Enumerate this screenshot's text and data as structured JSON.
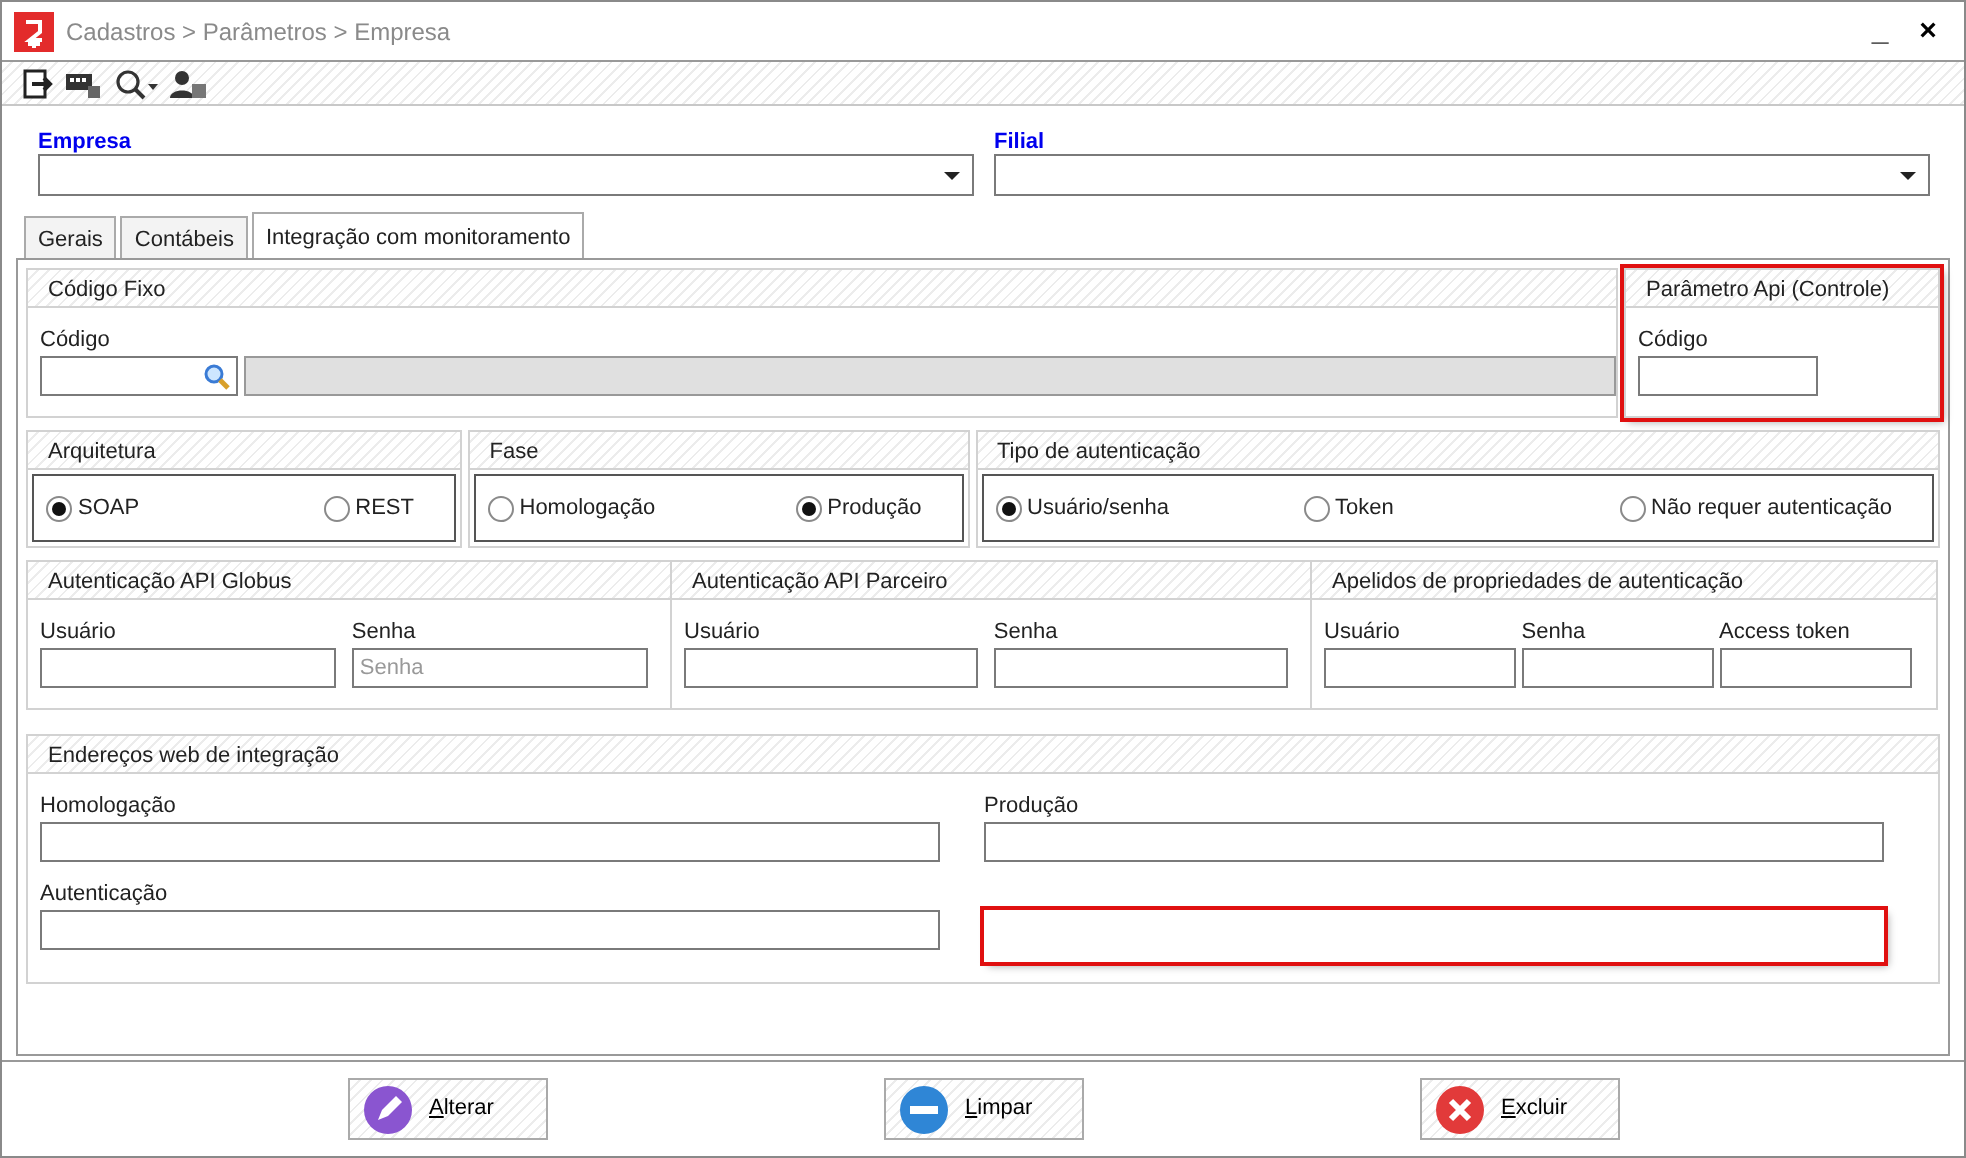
{
  "window": {
    "title": "Cadastros > Parâmetros > Empresa",
    "controls": [
      "_",
      "×"
    ]
  },
  "toolbar": [
    {
      "kind": "exit"
    },
    {
      "kind": "keyboard"
    },
    {
      "kind": "search"
    },
    {
      "kind": "user"
    }
  ],
  "selectors": [
    {
      "label": "Empresa"
    },
    {
      "label": "Filial"
    }
  ],
  "tabs": [
    {
      "label": "Gerais",
      "selected": false
    },
    {
      "label": "Contábeis",
      "selected": false
    },
    {
      "label": "Integração com monitoramento",
      "selected": true
    }
  ],
  "codigo_fixo": {
    "title": "Código Fixo",
    "field_label": "Código"
  },
  "parametro_api": {
    "title": "Parâmetro Api (Controle)",
    "field_label": "Código",
    "highlighted": true
  },
  "radio_groups": [
    {
      "title": "Arquitetura",
      "options": [
        {
          "label": "SOAP",
          "selected": true
        },
        {
          "label": "REST",
          "selected": false
        }
      ]
    },
    {
      "title": "Fase",
      "options": [
        {
          "label": "Homologação",
          "selected": false
        },
        {
          "label": "Produção",
          "selected": true
        }
      ]
    },
    {
      "title": "Tipo de autenticação",
      "options": [
        {
          "label": "Usuário/senha",
          "selected": true
        },
        {
          "label": "Token",
          "selected": false
        },
        {
          "label": "Não requer autenticação",
          "selected": false
        }
      ]
    }
  ],
  "auth_panels": [
    {
      "title": "Autenticação API Globus",
      "fields": [
        {
          "label": "Usuário"
        },
        {
          "label": "Senha",
          "placeholder": "Senha"
        }
      ]
    },
    {
      "title": "Autenticação API Parceiro",
      "fields": [
        {
          "label": "Usuário"
        },
        {
          "label": "Senha"
        }
      ]
    },
    {
      "title": "Apelidos de propriedades de autenticação",
      "fields": [
        {
          "label": "Usuário"
        },
        {
          "label": "Senha"
        },
        {
          "label": "Access token"
        }
      ]
    }
  ],
  "urls": {
    "title": "Endereços web de integração",
    "fields": [
      {
        "label": "Homologação"
      },
      {
        "label": "Produção"
      },
      {
        "label": "Autenticação"
      }
    ],
    "highlight_box": true
  },
  "buttons": [
    {
      "label": "Alterar",
      "kind": "edit",
      "mnemonic": true
    },
    {
      "label": "Limpar",
      "kind": "clear",
      "mnemonic": true
    },
    {
      "label": "Excluir",
      "kind": "delete",
      "mnemonic": true
    }
  ]
}
